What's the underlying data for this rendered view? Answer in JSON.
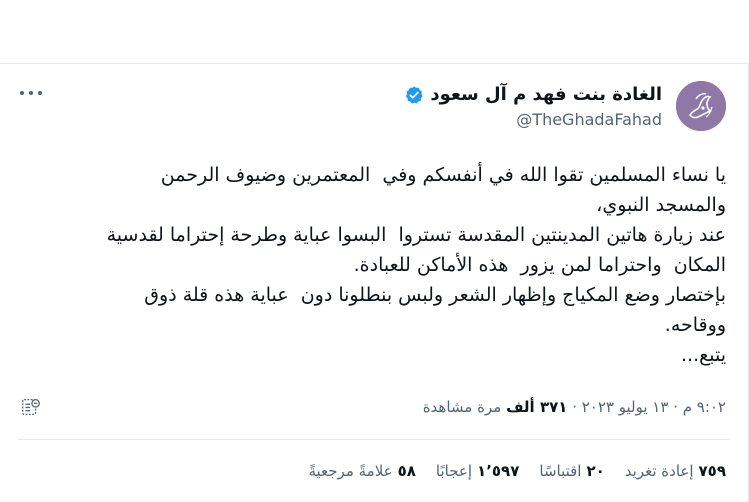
{
  "tweet": {
    "display_name": "الغادة بنت فهد م آل سعود",
    "handle": "@TheGhadaFahad",
    "body_lines": [
      "يا نساء المسلمين تقوا الله في أنفسكم وفي  المعتمرين وضيوف الرحمن",
      "والمسجد النبوي،",
      "عند زيارة هاتين المدينتين المقدسة تستروا  البسوا عباية وطرحة إحتراما لقدسية",
      "المكان  واحتراما لمن يزور  هذه الأماكن للعبادة.",
      "بإختصار وضع المكياج وإظهار الشعر ولبس بنطلونا دون  عباية هذه قلة ذوق",
      "ووقاحه.",
      "يتبع..."
    ],
    "timestamp": "٩:٠٢ م · ١٣ يوليو ٢٠٢٣ ·",
    "views_count": "٣٧١ ألف",
    "views_label": "مرة مشاهدة",
    "stats": {
      "retweets_count": "٧٥٩",
      "retweets_label": "إعادة تغريد",
      "quotes_count": "٢٠",
      "quotes_label": "اقتباسًا",
      "likes_count": "١٬٥٩٧",
      "likes_label": "إعجابًا",
      "bookmarks_count": "٥٨",
      "bookmarks_label": "علامةً مرجعيةً"
    }
  },
  "icons": {
    "more": "more-dots-icon",
    "verified": "verified-badge-icon",
    "analytics": "analytics-icon"
  },
  "colors": {
    "verified_blue": "#1d9bf0",
    "avatar_purple": "#8f78a8",
    "secondary_text": "#536471",
    "primary_text": "#0f1419"
  }
}
